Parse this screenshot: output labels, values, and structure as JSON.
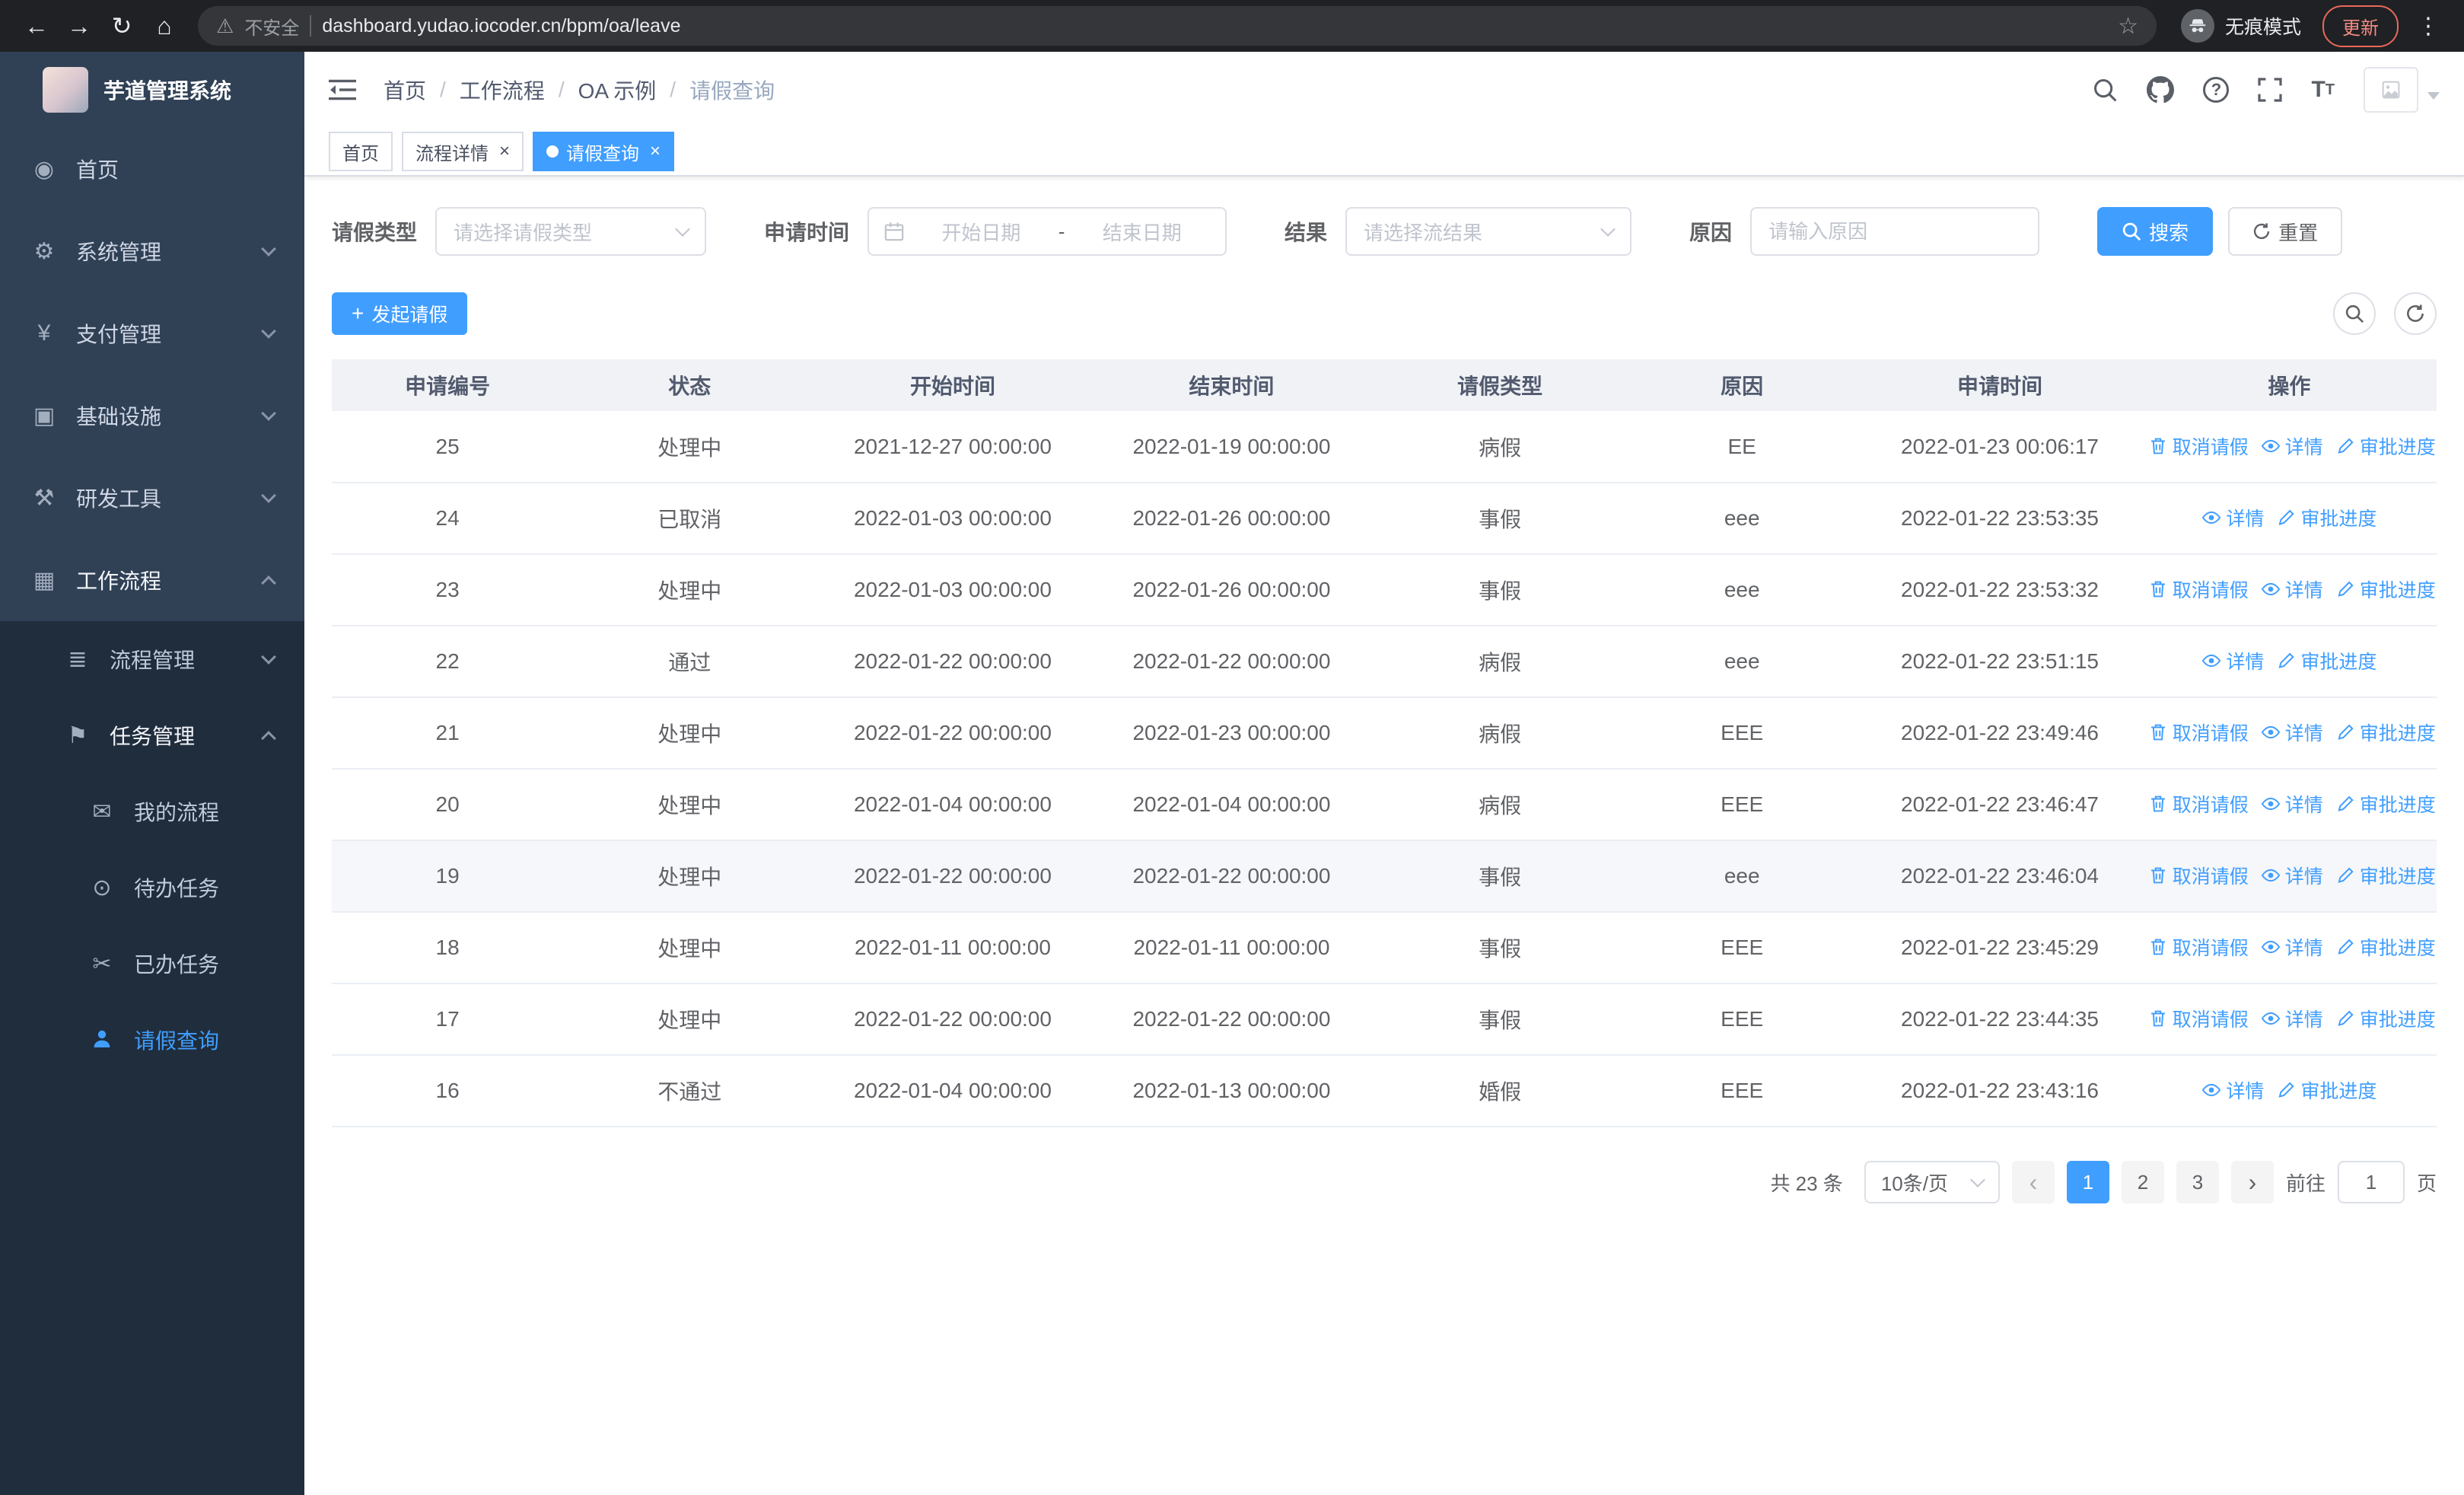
{
  "browser": {
    "security_warning": "不安全",
    "url": "dashboard.yudao.iocoder.cn/bpm/oa/leave",
    "incognito_label": "无痕模式",
    "update_label": "更新"
  },
  "colors": {
    "accent": "#409eff",
    "sidebar_bg": "#304156",
    "sidebar_sub_bg": "#1f2d3d"
  },
  "sidebar": {
    "logo_title": "芋道管理系统",
    "items": [
      {
        "name": "home",
        "label": "首页",
        "icon": "dashboard-icon",
        "level": 1,
        "expandable": false,
        "expanded": false,
        "active": false
      },
      {
        "name": "system-management",
        "label": "系统管理",
        "icon": "gear-icon",
        "level": 1,
        "expandable": true,
        "expanded": false,
        "active": false
      },
      {
        "name": "payment-management",
        "label": "支付管理",
        "icon": "yen-icon",
        "level": 1,
        "expandable": true,
        "expanded": false,
        "active": false
      },
      {
        "name": "infrastructure",
        "label": "基础设施",
        "icon": "monitor-icon",
        "level": 1,
        "expandable": true,
        "expanded": false,
        "active": false
      },
      {
        "name": "dev-tools",
        "label": "研发工具",
        "icon": "tools-icon",
        "level": 1,
        "expandable": true,
        "expanded": false,
        "active": false
      },
      {
        "name": "workflow",
        "label": "工作流程",
        "icon": "suitcase-icon",
        "level": 1,
        "expandable": true,
        "expanded": true,
        "active": false
      },
      {
        "name": "process-management",
        "label": "流程管理",
        "icon": "process-list-icon",
        "level": 2,
        "expandable": true,
        "expanded": false,
        "active": false
      },
      {
        "name": "task-management",
        "label": "任务管理",
        "icon": "flag-icon",
        "level": 2,
        "expandable": true,
        "expanded": true,
        "active": false
      },
      {
        "name": "my-processes",
        "label": "我的流程",
        "icon": "message-icon",
        "level": 3,
        "expandable": false,
        "expanded": false,
        "active": false
      },
      {
        "name": "todo-tasks",
        "label": "待办任务",
        "icon": "eye-icon",
        "level": 3,
        "expandable": false,
        "expanded": false,
        "active": false
      },
      {
        "name": "done-tasks",
        "label": "已办任务",
        "icon": "scissors-icon",
        "level": 3,
        "expandable": false,
        "expanded": false,
        "active": false
      },
      {
        "name": "leave-query",
        "label": "请假查询",
        "icon": "user-icon",
        "level": 3,
        "expandable": false,
        "expanded": false,
        "active": true
      }
    ]
  },
  "header": {
    "breadcrumb": [
      "首页",
      "工作流程",
      "OA 示例",
      "请假查询"
    ]
  },
  "tabs": [
    {
      "label": "首页",
      "closable": false,
      "active": false
    },
    {
      "label": "流程详情",
      "closable": true,
      "active": false
    },
    {
      "label": "请假查询",
      "closable": true,
      "active": true
    }
  ],
  "filters": {
    "leave_type_label": "请假类型",
    "leave_type_placeholder": "请选择请假类型",
    "apply_time_label": "申请时间",
    "date_start_placeholder": "开始日期",
    "date_separator": "-",
    "date_end_placeholder": "结束日期",
    "result_label": "结果",
    "result_placeholder": "请选择流结果",
    "reason_label": "原因",
    "reason_placeholder": "请输入原因",
    "search_label": "搜索",
    "reset_label": "重置"
  },
  "toolbar": {
    "create_label": "发起请假"
  },
  "table": {
    "columns": [
      "申请编号",
      "状态",
      "开始时间",
      "结束时间",
      "请假类型",
      "原因",
      "申请时间",
      "操作"
    ],
    "action_defs": {
      "cancel": {
        "label": "取消请假",
        "icon": "delete-icon",
        "name": "cancel-leave-link"
      },
      "detail": {
        "label": "详情",
        "icon": "view-icon",
        "name": "detail-link"
      },
      "progress": {
        "label": "审批进度",
        "icon": "edit-icon",
        "name": "approval-progress-link"
      }
    },
    "rows": [
      {
        "id": "25",
        "status": "处理中",
        "start": "2021-12-27 00:00:00",
        "end": "2022-01-19 00:00:00",
        "type": "病假",
        "reason": "EE",
        "applied": "2022-01-23 00:06:17",
        "actions": [
          "cancel",
          "detail",
          "progress"
        ],
        "hover": false
      },
      {
        "id": "24",
        "status": "已取消",
        "start": "2022-01-03 00:00:00",
        "end": "2022-01-26 00:00:00",
        "type": "事假",
        "reason": "eee",
        "applied": "2022-01-22 23:53:35",
        "actions": [
          "detail",
          "progress"
        ],
        "hover": false
      },
      {
        "id": "23",
        "status": "处理中",
        "start": "2022-01-03 00:00:00",
        "end": "2022-01-26 00:00:00",
        "type": "事假",
        "reason": "eee",
        "applied": "2022-01-22 23:53:32",
        "actions": [
          "cancel",
          "detail",
          "progress"
        ],
        "hover": false
      },
      {
        "id": "22",
        "status": "通过",
        "start": "2022-01-22 00:00:00",
        "end": "2022-01-22 00:00:00",
        "type": "病假",
        "reason": "eee",
        "applied": "2022-01-22 23:51:15",
        "actions": [
          "detail",
          "progress"
        ],
        "hover": false
      },
      {
        "id": "21",
        "status": "处理中",
        "start": "2022-01-22 00:00:00",
        "end": "2022-01-23 00:00:00",
        "type": "病假",
        "reason": "EEE",
        "applied": "2022-01-22 23:49:46",
        "actions": [
          "cancel",
          "detail",
          "progress"
        ],
        "hover": false
      },
      {
        "id": "20",
        "status": "处理中",
        "start": "2022-01-04 00:00:00",
        "end": "2022-01-04 00:00:00",
        "type": "病假",
        "reason": "EEE",
        "applied": "2022-01-22 23:46:47",
        "actions": [
          "cancel",
          "detail",
          "progress"
        ],
        "hover": false
      },
      {
        "id": "19",
        "status": "处理中",
        "start": "2022-01-22 00:00:00",
        "end": "2022-01-22 00:00:00",
        "type": "事假",
        "reason": "eee",
        "applied": "2022-01-22 23:46:04",
        "actions": [
          "cancel",
          "detail",
          "progress"
        ],
        "hover": true
      },
      {
        "id": "18",
        "status": "处理中",
        "start": "2022-01-11 00:00:00",
        "end": "2022-01-11 00:00:00",
        "type": "事假",
        "reason": "EEE",
        "applied": "2022-01-22 23:45:29",
        "actions": [
          "cancel",
          "detail",
          "progress"
        ],
        "hover": false
      },
      {
        "id": "17",
        "status": "处理中",
        "start": "2022-01-22 00:00:00",
        "end": "2022-01-22 00:00:00",
        "type": "事假",
        "reason": "EEE",
        "applied": "2022-01-22 23:44:35",
        "actions": [
          "cancel",
          "detail",
          "progress"
        ],
        "hover": false
      },
      {
        "id": "16",
        "status": "不通过",
        "start": "2022-01-04 00:00:00",
        "end": "2022-01-13 00:00:00",
        "type": "婚假",
        "reason": "EEE",
        "applied": "2022-01-22 23:43:16",
        "actions": [
          "detail",
          "progress"
        ],
        "hover": false
      }
    ]
  },
  "pagination": {
    "total_text": "共 23 条",
    "page_size": "10条/页",
    "pages": [
      "1",
      "2",
      "3"
    ],
    "active_page": "1",
    "goto_label": "前往",
    "goto_value": "1",
    "goto_suffix": "页"
  }
}
